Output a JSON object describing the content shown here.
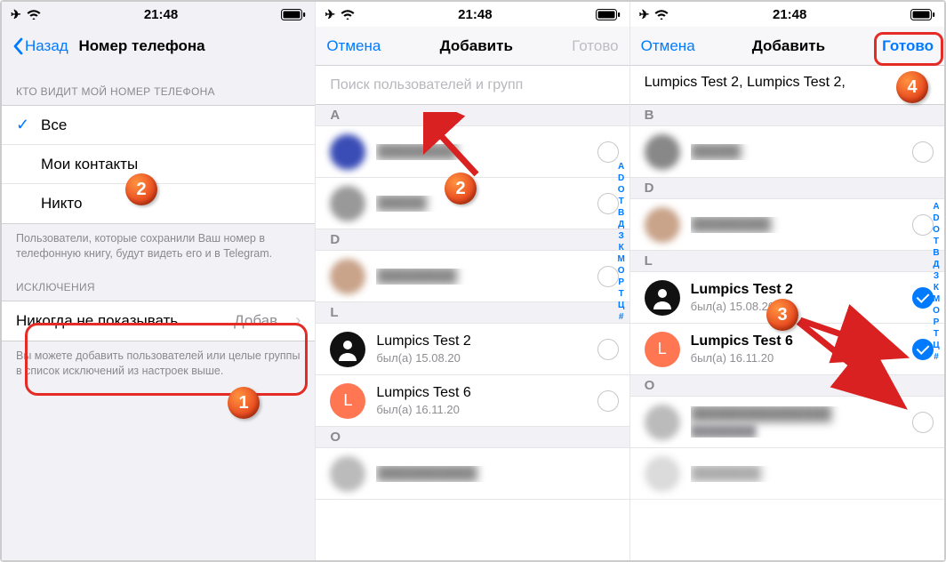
{
  "status": {
    "time": "21:48"
  },
  "panel1": {
    "back": "Назад",
    "title": "Номер телефона",
    "section_who": "КТО ВИДИТ МОЙ НОМЕР ТЕЛЕФОНА",
    "opt_all": "Все",
    "opt_contacts": "Мои контакты",
    "opt_nobody": "Никто",
    "footer_who": "Пользователи, которые сохранили Ваш номер в телефонную книгу, будут видеть его и в Telegram.",
    "section_exc": "ИСКЛЮЧЕНИЯ",
    "exc_never": "Никогда не показывать",
    "exc_add": "Добав...",
    "footer_exc": "Вы можете добавить пользователей или целые группы в список исключений из настроек выше."
  },
  "panel2": {
    "cancel": "Отмена",
    "title": "Добавить",
    "done": "Готово",
    "search_placeholder": "Поиск пользователей и групп",
    "hdr_a": "A",
    "hdr_d": "D",
    "hdr_l": "L",
    "hdr_o": "O",
    "contact_l1_name": "Lumpics Test 2",
    "contact_l1_sub": "был(а) 15.08.20",
    "contact_l2_name": "Lumpics Test 6",
    "contact_l2_sub": "был(а) 16.11.20",
    "index": [
      "A",
      "D",
      "O",
      "T",
      "В",
      "Д",
      "З",
      "К",
      "М",
      "О",
      "Р",
      "Т",
      "Ц",
      "#"
    ]
  },
  "panel3": {
    "cancel": "Отмена",
    "title": "Добавить",
    "done": "Готово",
    "tokens": "Lumpics Test 2,  Lumpics Test 2,",
    "hdr_b": "B",
    "hdr_d": "D",
    "hdr_l": "L",
    "hdr_o": "O",
    "contact_l1_name": "Lumpics Test 2",
    "contact_l1_sub": "был(а) 15.08.20",
    "contact_l2_name": "Lumpics Test 6",
    "contact_l2_sub": "был(а) 16.11.20",
    "index": [
      "A",
      "D",
      "O",
      "T",
      "В",
      "Д",
      "З",
      "К",
      "М",
      "О",
      "Р",
      "Т",
      "Ц",
      "#"
    ]
  },
  "badges": {
    "b1": "1",
    "b2": "2",
    "b3": "3",
    "b4": "4"
  }
}
